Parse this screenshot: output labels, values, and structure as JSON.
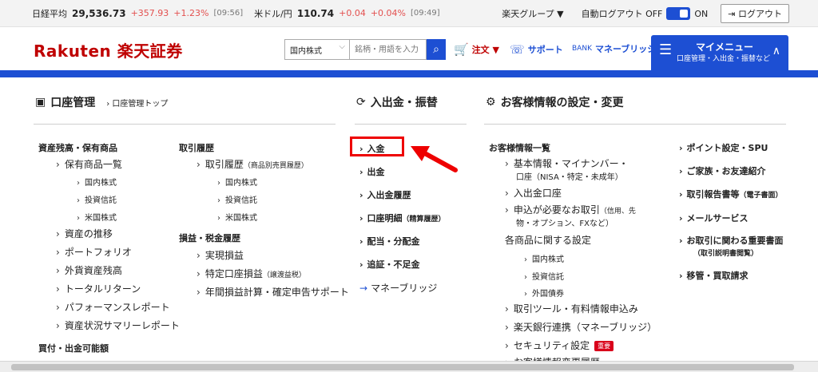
{
  "ticker": {
    "nikkei_label": "日経平均",
    "nikkei_value": "29,536.73",
    "nikkei_change": "+357.93",
    "nikkei_pct": "+1.23%",
    "nikkei_time": "[09:56]",
    "usd_label": "米ドル/円",
    "usd_value": "110.74",
    "usd_change": "+0.04",
    "usd_pct": "+0.04%",
    "usd_time": "[09:49]",
    "group": "楽天グループ ▼",
    "auto_logout": "自動ログアウト OFF",
    "on": "ON",
    "logout": "ログアウト"
  },
  "header": {
    "logo": "Rakuten 楽天証券",
    "search_select": "国内株式",
    "search_placeholder": "銘柄・用語を入力",
    "order": "注文 ▼",
    "support": "サポート",
    "money_bridge": "マネーブリッジ",
    "bank_small": "BANK",
    "mymenu_title": "マイメニュー",
    "mymenu_sub": "口座管理・入出金・振替など"
  },
  "col1": {
    "head": "口座管理",
    "sub": "口座管理トップ",
    "assets_head": "資産残高・保有商品",
    "assets": [
      "保有商品一覧",
      "資産の推移",
      "ポートフォリオ",
      "外貨資産残高",
      "トータルリターン",
      "パフォーマンスレポート",
      "資産状況サマリーレポート"
    ],
    "holding_sub": [
      "国内株式",
      "投資信託",
      "米国株式"
    ],
    "buyable_head": "買付・出金可能額",
    "trade_head": "取引履歴",
    "trade_item": "取引履歴",
    "trade_note": "（商品別売買履歴）",
    "trade_sub": [
      "国内株式",
      "投資信託",
      "米国株式"
    ],
    "tax_head": "損益・税金履歴",
    "tax_items": [
      "実現損益",
      "特定口座損益",
      "年間損益計算・確定申告サポート"
    ],
    "tax_note": "（譲渡益税）"
  },
  "col2": {
    "head": "入出金・振替",
    "items": [
      "入金",
      "出金",
      "入出金履歴",
      "口座明細",
      "配当・分配金",
      "追証・不足金"
    ],
    "detail_note": "（精算履歴）",
    "money_bridge": "マネーブリッジ"
  },
  "col3": {
    "head": "お客様情報の設定・変更",
    "info_head": "お客様情報一覧",
    "basic_line1": "基本情報・マイナンバー・",
    "basic_line2": "口座（NISA・特定・未成年）",
    "bank": "入出金口座",
    "apply_line1": "申込が必要なお取引",
    "apply_note1": "（信用、先",
    "apply_line2": "物・オプション、FXなど）",
    "settings_head": "各商品に関する設定",
    "settings_sub": [
      "国内株式",
      "投資信託",
      "外国債券"
    ],
    "tools": "取引ツール・有料情報申込み",
    "bank_link": "楽天銀行連携（マネーブリッジ）",
    "security": "セキュリティ設定",
    "badge": "重要",
    "change_history": "お客様情報変更履歴"
  },
  "col4": {
    "items": [
      "ポイント設定・SPU",
      "ご家族・お友達紹介",
      "取引報告書等",
      "メールサービス",
      "お取引に関わる重要書面",
      "移管・買取請求"
    ],
    "report_note": "（電子書面）",
    "important_note": "（取引説明書閲覧）"
  },
  "colors": {
    "brand": "#bf0000",
    "primary": "#1d4fd3",
    "up": "#e3504f",
    "highlight": "#ee0000"
  }
}
